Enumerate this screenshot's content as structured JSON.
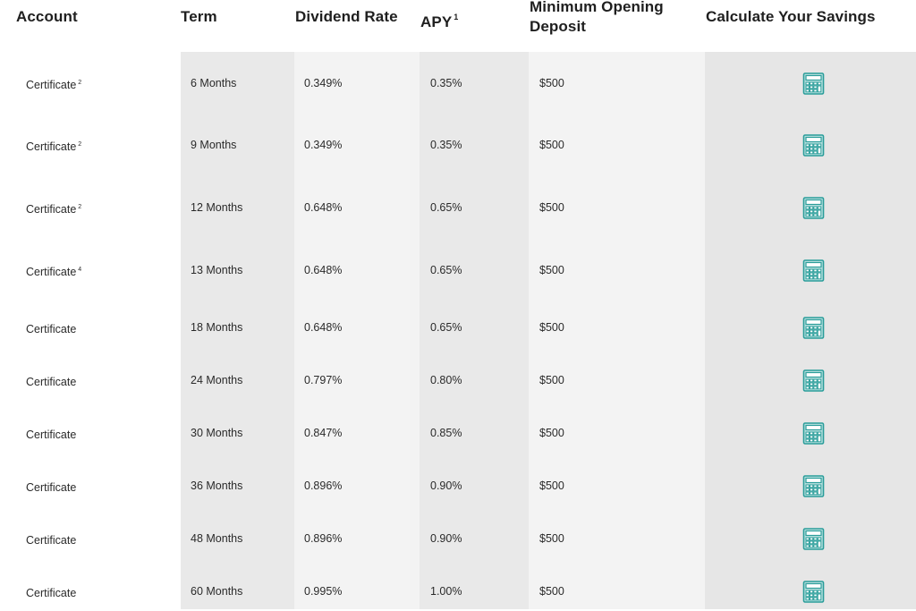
{
  "headers": {
    "account": "Account",
    "term": "Term",
    "dividend_rate": "Dividend Rate",
    "apy": "APY",
    "apy_note": "1",
    "min_deposit_line1": "Minimum Opening",
    "min_deposit_line2": "Deposit",
    "calculate": "Calculate Your Savings"
  },
  "icon": "calculator-icon",
  "accent_color": "#2a9d9a",
  "rows": [
    {
      "account": "Certificate",
      "note": "2",
      "term": "6 Months",
      "dividend_rate": "0.349%",
      "apy": "0.35%",
      "min_deposit": "$500"
    },
    {
      "account": "Certificate",
      "note": "2",
      "term": "9 Months",
      "dividend_rate": "0.349%",
      "apy": "0.35%",
      "min_deposit": "$500"
    },
    {
      "account": "Certificate",
      "note": "2",
      "term": "12 Months",
      "dividend_rate": "0.648%",
      "apy": "0.65%",
      "min_deposit": "$500"
    },
    {
      "account": "Certificate",
      "note": "4",
      "term": "13 Months",
      "dividend_rate": "0.648%",
      "apy": "0.65%",
      "min_deposit": "$500"
    },
    {
      "account": "Certificate",
      "note": "",
      "term": "18 Months",
      "dividend_rate": "0.648%",
      "apy": "0.65%",
      "min_deposit": "$500"
    },
    {
      "account": "Certificate",
      "note": "",
      "term": "24 Months",
      "dividend_rate": "0.797%",
      "apy": "0.80%",
      "min_deposit": "$500"
    },
    {
      "account": "Certificate",
      "note": "",
      "term": "30 Months",
      "dividend_rate": "0.847%",
      "apy": "0.85%",
      "min_deposit": "$500"
    },
    {
      "account": "Certificate",
      "note": "",
      "term": "36 Months",
      "dividend_rate": "0.896%",
      "apy": "0.90%",
      "min_deposit": "$500"
    },
    {
      "account": "Certificate",
      "note": "",
      "term": "48 Months",
      "dividend_rate": "0.896%",
      "apy": "0.90%",
      "min_deposit": "$500"
    },
    {
      "account": "Certificate",
      "note": "",
      "term": "60 Months",
      "dividend_rate": "0.995%",
      "apy": "1.00%",
      "min_deposit": "$500"
    }
  ]
}
